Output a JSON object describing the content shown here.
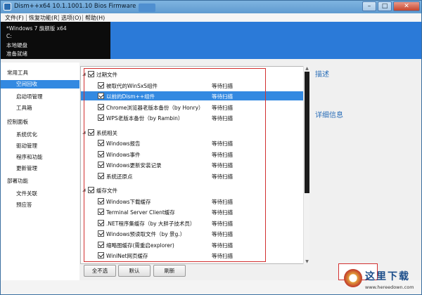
{
  "window": {
    "title": "Dism++x64 10.1.1001.10 Bios Firmware",
    "buttons": {
      "minimize": "–",
      "maximize": "□",
      "close": "✕"
    }
  },
  "menu": [
    "文件(F)",
    "恢复功能(R)",
    "选项(O)",
    "帮助(H)"
  ],
  "info": {
    "os": "*Windows 7 旗舰版 x64",
    "drive": "C:",
    "disk": "本地硬盘",
    "status": "准备就绪"
  },
  "sidebar": {
    "categories": [
      {
        "label": "常用工具",
        "items": [
          "空间回收",
          "启动项管理",
          "工具箱"
        ]
      },
      {
        "label": "控制面板",
        "items": [
          "系统优化",
          "驱动管理",
          "程序和功能",
          "更新管理"
        ]
      },
      {
        "label": "部署功能",
        "items": [
          "文件关联",
          "预应答"
        ]
      }
    ],
    "selected": "空间回收"
  },
  "tree": [
    {
      "type": "group",
      "label": "过期文件"
    },
    {
      "type": "item",
      "label": "被取代的WinSxS组件",
      "status": "等待扫描"
    },
    {
      "type": "item",
      "label": "以前的Dism++组件",
      "status": "等待扫描",
      "selected": true
    },
    {
      "type": "item",
      "label": "Chrome浏览器老版本备份（by Honry）",
      "status": "等待扫描"
    },
    {
      "type": "item",
      "label": "WPS老版本备份（by Rambin）",
      "status": "等待扫描"
    },
    {
      "type": "group",
      "label": "系统相关"
    },
    {
      "type": "item",
      "label": "Windows报告",
      "status": "等待扫描"
    },
    {
      "type": "item",
      "label": "Windows事件",
      "status": "等待扫描"
    },
    {
      "type": "item",
      "label": "Windows更新安装记录",
      "status": "等待扫描"
    },
    {
      "type": "item",
      "label": "系统还原点",
      "status": "等待扫描"
    },
    {
      "type": "group",
      "label": "缓存文件"
    },
    {
      "type": "item",
      "label": "Windows下载缓存",
      "status": "等待扫描"
    },
    {
      "type": "item",
      "label": "Terminal Server Client缓存",
      "status": "等待扫描"
    },
    {
      "type": "item",
      "label": ".NET程序集缓存（by 大胖子技术员）",
      "status": "等待扫描"
    },
    {
      "type": "item",
      "label": "Windows预读取文件（by 景g.）",
      "status": "等待扫描"
    },
    {
      "type": "item",
      "label": "缩略图缓存(需重启explorer)",
      "status": "等待扫描"
    },
    {
      "type": "item",
      "label": "WinINet网页缓存",
      "status": "等待扫描"
    }
  ],
  "right_panel": {
    "description": "描述",
    "details": "详细信息"
  },
  "buttons": {
    "select_none": "全不选",
    "default": "默认",
    "refresh": "刷新"
  },
  "watermark": {
    "text": "这里下载",
    "url": "www.hereedown.com"
  },
  "colors": {
    "accent": "#3389e1",
    "highlight_frame": "#d23030",
    "info_bg": "#0c0c0c"
  }
}
